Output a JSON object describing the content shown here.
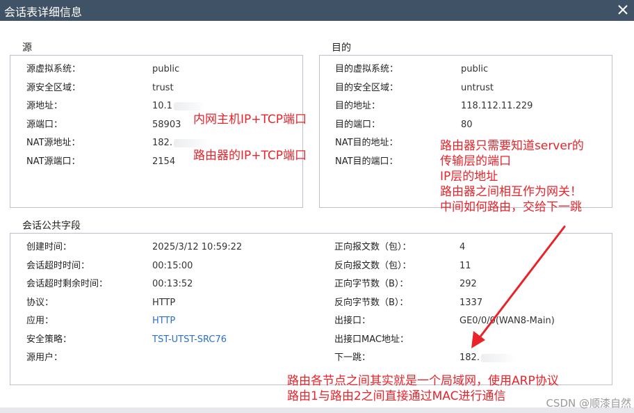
{
  "dialog": {
    "title": "会话表详细信息"
  },
  "source": {
    "heading": "源",
    "rows": [
      {
        "label": "源虚拟系统：",
        "value": "public"
      },
      {
        "label": "源安全区域：",
        "value": "trust"
      },
      {
        "label": "源地址：",
        "value": "10.1"
      },
      {
        "label": "源端口：",
        "value": "58903"
      },
      {
        "label": "NAT源地址：",
        "value": "182."
      },
      {
        "label": "NAT源端口：",
        "value": "2154"
      }
    ]
  },
  "destination": {
    "heading": "目的",
    "rows": [
      {
        "label": "目的虚拟系统：",
        "value": "public"
      },
      {
        "label": "目的安全区域：",
        "value": "untrust"
      },
      {
        "label": "目的地址：",
        "value": "118.112.11.229"
      },
      {
        "label": "目的端口：",
        "value": "80"
      },
      {
        "label": "NAT目的地址：",
        "value": ""
      },
      {
        "label": "NAT目的端口：",
        "value": ""
      }
    ]
  },
  "common": {
    "heading": "会话公共字段",
    "left": [
      {
        "label": "创建时间：",
        "value": "2025/3/12 10:59:22"
      },
      {
        "label": "会话超时时间：",
        "value": "00:15:00"
      },
      {
        "label": "会话超时剩余时间：",
        "value": "00:13:52"
      },
      {
        "label": "协议：",
        "value": "HTTP"
      },
      {
        "label": "应用：",
        "value": "HTTP"
      },
      {
        "label": "安全策略：",
        "value": "TST-UTST-SRC76"
      },
      {
        "label": "源用户：",
        "value": ""
      }
    ],
    "right": [
      {
        "label": "正向报文数（包）：",
        "value": "4"
      },
      {
        "label": "反向报文数（包）：",
        "value": "11"
      },
      {
        "label": "正向字节数（B）：",
        "value": "292"
      },
      {
        "label": "反向字节数（B）：",
        "value": "1337"
      },
      {
        "label": "出接口：",
        "value": "GE0/0/0(WAN8-Main)"
      },
      {
        "label": "出接口MAC地址：",
        "value": ""
      },
      {
        "label": "下一跳：",
        "value": "182."
      }
    ]
  },
  "annotations": {
    "src_host": "内网主机IP+TCP端口",
    "router_port": "路由器的IP+TCP端口",
    "router_note": [
      "路由器只需要知道server的",
      "传输层的端口",
      "IP层的地址",
      "路由器之间相互作为网关！",
      "中间如何路由，交给下一跳"
    ],
    "lan_note": [
      "路由各节点之间其实就是一个局域网，使用ARP协议",
      "路由1与路由2之间直接通过MAC进行通信"
    ]
  },
  "watermark": "CSDN @顺漆自然",
  "colors": {
    "titlebar": "#3f5266",
    "annotation": "#e8232a",
    "link": "#2a6fc9",
    "border": "#b9c2cc"
  }
}
